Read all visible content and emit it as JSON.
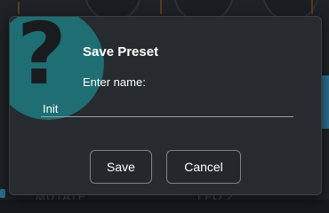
{
  "dialog": {
    "title": "Save Preset",
    "prompt": "Enter name:",
    "name_value": "Init",
    "icon": "question-mark-icon",
    "save_label": "Save",
    "cancel_label": "Cancel"
  },
  "background": {
    "label_left": "MUTATE",
    "label_right": "LFO 2"
  },
  "colors": {
    "dialog_bg": "#262b2f",
    "help_circle": "#1e6e73",
    "accent_orange": "#5a3a1c",
    "accent_blue": "#2c6d8f"
  }
}
